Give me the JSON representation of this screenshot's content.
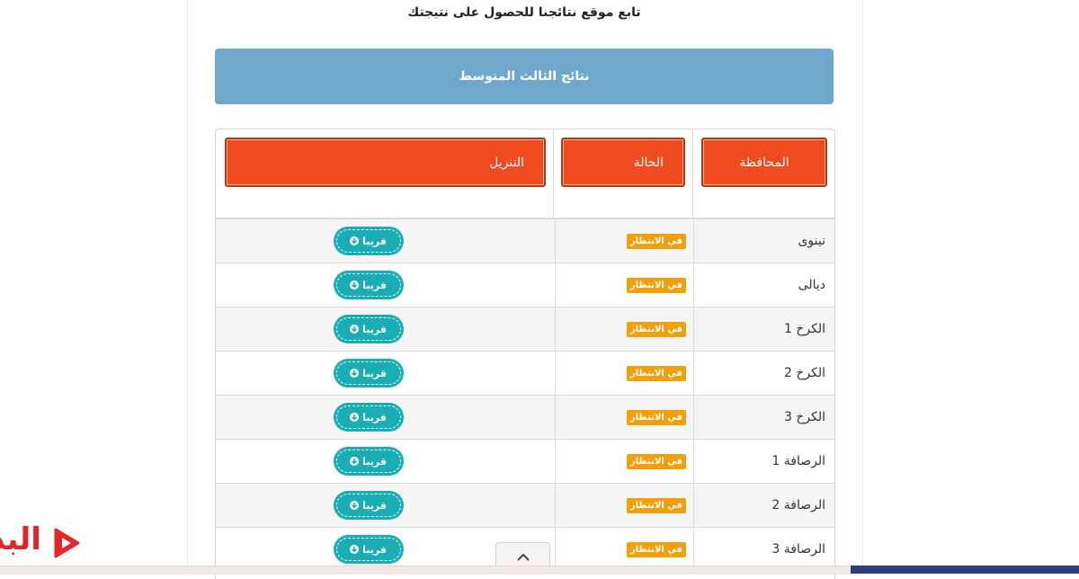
{
  "header": {
    "tagline": "تابع موقع نتائجنا للحصول على نتيجتك",
    "banner_title": "نتائج الثالث المتوسط"
  },
  "table": {
    "columns": {
      "governorate": "المحافظة",
      "status": "الحالة",
      "download": "التنزيل"
    },
    "rows": [
      {
        "governorate": "نينوى",
        "status": "في الانتظار",
        "download": "قريبا"
      },
      {
        "governorate": "ديالى",
        "status": "في الانتظار",
        "download": "قريبا"
      },
      {
        "governorate": "الكرخ 1",
        "status": "في الانتظار",
        "download": "قريبا"
      },
      {
        "governorate": "الكرخ 2",
        "status": "في الانتظار",
        "download": "قريبا"
      },
      {
        "governorate": "الكرخ 3",
        "status": "في الانتظار",
        "download": "قريبا"
      },
      {
        "governorate": "الرصافة 1",
        "status": "في الانتظار",
        "download": "قريبا"
      },
      {
        "governorate": "الرصافة 2",
        "status": "في الانتظار",
        "download": "قريبا"
      },
      {
        "governorate": "الرصافة 3",
        "status": "في الانتظار",
        "download": "قريبا"
      }
    ]
  },
  "logo": {
    "text": "البد"
  },
  "colors": {
    "banner": "#6fa8cb",
    "header_cell": "#f04a1f",
    "status_badge": "#f0a00a",
    "download_button": "#1aaeb4"
  },
  "icons": {
    "download": "arrow-down-circle-icon",
    "scroll_top": "chevron-up-icon",
    "logo_mark": "play-icon"
  }
}
